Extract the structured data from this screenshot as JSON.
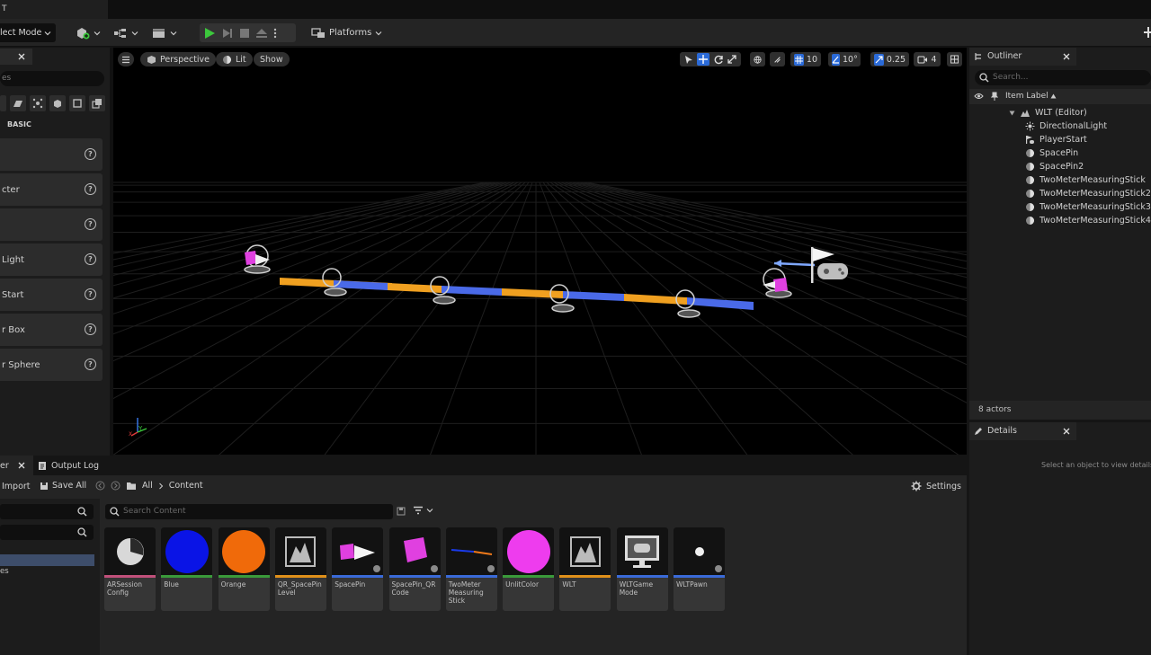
{
  "window": {
    "title": "T"
  },
  "toolbar": {
    "mode_label": "lect Mode",
    "platforms_label": "Platforms"
  },
  "place_actors": {
    "search_placeholder": "es",
    "category_label": "BASIC",
    "items": [
      {
        "label": ""
      },
      {
        "label": "cter"
      },
      {
        "label": ""
      },
      {
        "label": "Light"
      },
      {
        "label": " Start"
      },
      {
        "label": "r Box"
      },
      {
        "label": "r Sphere"
      }
    ]
  },
  "viewport": {
    "perspective_label": "Perspective",
    "lit_label": "Lit",
    "show_label": "Show",
    "grid_snap": "10",
    "rotation_snap": "10°",
    "scale_snap": "0.25",
    "camera_speed": "4",
    "axis_labels": {
      "y": "Y",
      "x": "X",
      "z": "Z"
    }
  },
  "outliner": {
    "tab_label": "Outliner",
    "search_placeholder": "Search...",
    "column_label": "Item Label",
    "root": "WLT (Editor)",
    "items": [
      {
        "label": "DirectionalLight",
        "icon": "sun-icon"
      },
      {
        "label": "PlayerStart",
        "icon": "flag-icon"
      },
      {
        "label": "SpacePin",
        "icon": "actor-icon"
      },
      {
        "label": "SpacePin2",
        "icon": "actor-icon"
      },
      {
        "label": "TwoMeterMeasuringStick",
        "icon": "actor-icon"
      },
      {
        "label": "TwoMeterMeasuringStick2",
        "icon": "actor-icon"
      },
      {
        "label": "TwoMeterMeasuringStick3",
        "icon": "actor-icon"
      },
      {
        "label": "TwoMeterMeasuringStick4",
        "icon": "actor-icon"
      }
    ],
    "count_label": "8 actors"
  },
  "details": {
    "tab_label": "Details",
    "empty_message": "Select an object to view details."
  },
  "bottom_tabs": {
    "content_browser_label": "er",
    "output_log_label": "Output Log"
  },
  "content_browser": {
    "import_label": "Import",
    "save_all_label": "Save All",
    "path": [
      "All",
      "Content"
    ],
    "settings_label": "Settings",
    "search_placeholder": "Search Content",
    "tree_item_partial": "es",
    "assets": [
      {
        "label": "ARSession Config",
        "stripe": "#c0507a",
        "kind": "data"
      },
      {
        "label": "Blue",
        "stripe": "#3a9a3a",
        "kind": "blue"
      },
      {
        "label": "Orange",
        "stripe": "#3a9a3a",
        "kind": "orange"
      },
      {
        "label": "QR_SpacePin Level",
        "stripe": "#e0901a",
        "kind": "level"
      },
      {
        "label": "SpacePin",
        "stripe": "#3a6ad8",
        "kind": "spacepin"
      },
      {
        "label": "SpacePin_QR Code",
        "stripe": "#3a6ad8",
        "kind": "spacepinqr"
      },
      {
        "label": "TwoMeter Measuring Stick",
        "stripe": "#3a6ad8",
        "kind": "stick"
      },
      {
        "label": "UnlitColor",
        "stripe": "#3a9a3a",
        "kind": "magenta"
      },
      {
        "label": "WLT",
        "stripe": "#e0901a",
        "kind": "level"
      },
      {
        "label": "WLTGame Mode",
        "stripe": "#3a6ad8",
        "kind": "gamemode"
      },
      {
        "label": "WLTPawn",
        "stripe": "#3a6ad8",
        "kind": "pawn"
      }
    ]
  },
  "colors": {
    "accent_blue": "#2a6ad8",
    "play_green": "#3cc83c",
    "stick_orange": "#f0a020",
    "stick_blue": "#4a6ae8"
  }
}
